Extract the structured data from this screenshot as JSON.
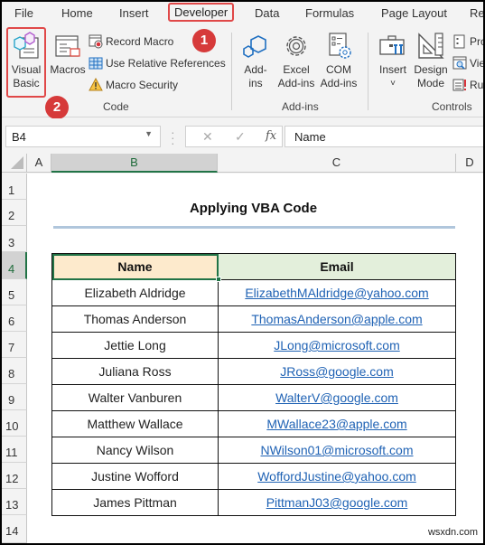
{
  "tabs": [
    {
      "label": "File",
      "active": false
    },
    {
      "label": "Home",
      "active": false
    },
    {
      "label": "Insert",
      "active": false
    },
    {
      "label": "Developer",
      "active": true
    },
    {
      "label": "Data",
      "active": false
    },
    {
      "label": "Formulas",
      "active": false
    },
    {
      "label": "Page Layout",
      "active": false
    },
    {
      "label": "Re",
      "active": false
    }
  ],
  "ribbon": {
    "code": {
      "label": "Code",
      "visual_basic": {
        "line1": "Visual",
        "line2": "Basic",
        "icon": "visual-basic-icon"
      },
      "macros": {
        "label": "Macros",
        "icon": "macros-icon"
      },
      "record_macro": {
        "label": "Record Macro",
        "icon": "record-macro-icon"
      },
      "relative_refs": {
        "label": "Use Relative References",
        "icon": "grid-icon"
      },
      "macro_security": {
        "label": "Macro Security",
        "icon": "warning-icon"
      }
    },
    "addins": {
      "label": "Add-ins",
      "addins": {
        "line1": "Add-",
        "line2": "ins",
        "icon": "hexagon-icon"
      },
      "excel_addins": {
        "line1": "Excel",
        "line2": "Add-ins",
        "icon": "gear-icon"
      },
      "com_addins": {
        "line1": "COM",
        "line2": "Add-ins",
        "icon": "com-addins-icon"
      }
    },
    "controls": {
      "label": "Controls",
      "insert": {
        "label": "Insert",
        "caret": "˅",
        "icon": "toolbox-icon"
      },
      "design_mode": {
        "line1": "Design",
        "line2": "Mode",
        "icon": "set-square-icon"
      },
      "properties": {
        "label": "Pro",
        "icon": "properties-icon"
      },
      "view_code": {
        "label": "Vie",
        "icon": "view-code-icon"
      },
      "run_dialog": {
        "label": "Ru",
        "icon": "run-dialog-icon"
      }
    },
    "badges": [
      "1",
      "2"
    ],
    "highlight_color": "#e04848"
  },
  "formula_bar": {
    "name_box": "B4",
    "cancel": "✕",
    "enter": "✓",
    "fx": "fx",
    "value": "Name"
  },
  "columns": [
    "A",
    "B",
    "C",
    "D"
  ],
  "selected_column": "B",
  "rows": [
    "1",
    "2",
    "3",
    "4",
    "5",
    "6",
    "7",
    "8",
    "9",
    "10",
    "11",
    "12",
    "13",
    "14"
  ],
  "selected_row": "4",
  "sheet": {
    "title": "Applying VBA Code",
    "headers": [
      "Name",
      "Email"
    ],
    "records": [
      {
        "name": "Elizabeth Aldridge",
        "email": "ElizabethMAldridge@yahoo.com"
      },
      {
        "name": "Thomas Anderson",
        "email": "ThomasAnderson@apple.com"
      },
      {
        "name": "Jettie Long",
        "email": "JLong@microsoft.com"
      },
      {
        "name": "Juliana Ross",
        "email": "JRoss@google.com"
      },
      {
        "name": "Walter Vanburen",
        "email": "WalterV@google.com"
      },
      {
        "name": "Matthew Wallace",
        "email": "MWallace23@apple.com"
      },
      {
        "name": "Nancy Wilson",
        "email": "NWilson01@microsoft.com"
      },
      {
        "name": "Justine Wofford",
        "email": "WoffordJustine@yahoo.com"
      },
      {
        "name": "James Pittman",
        "email": "PittmanJ03@google.com"
      }
    ]
  },
  "watermark": "wsxdn.com"
}
